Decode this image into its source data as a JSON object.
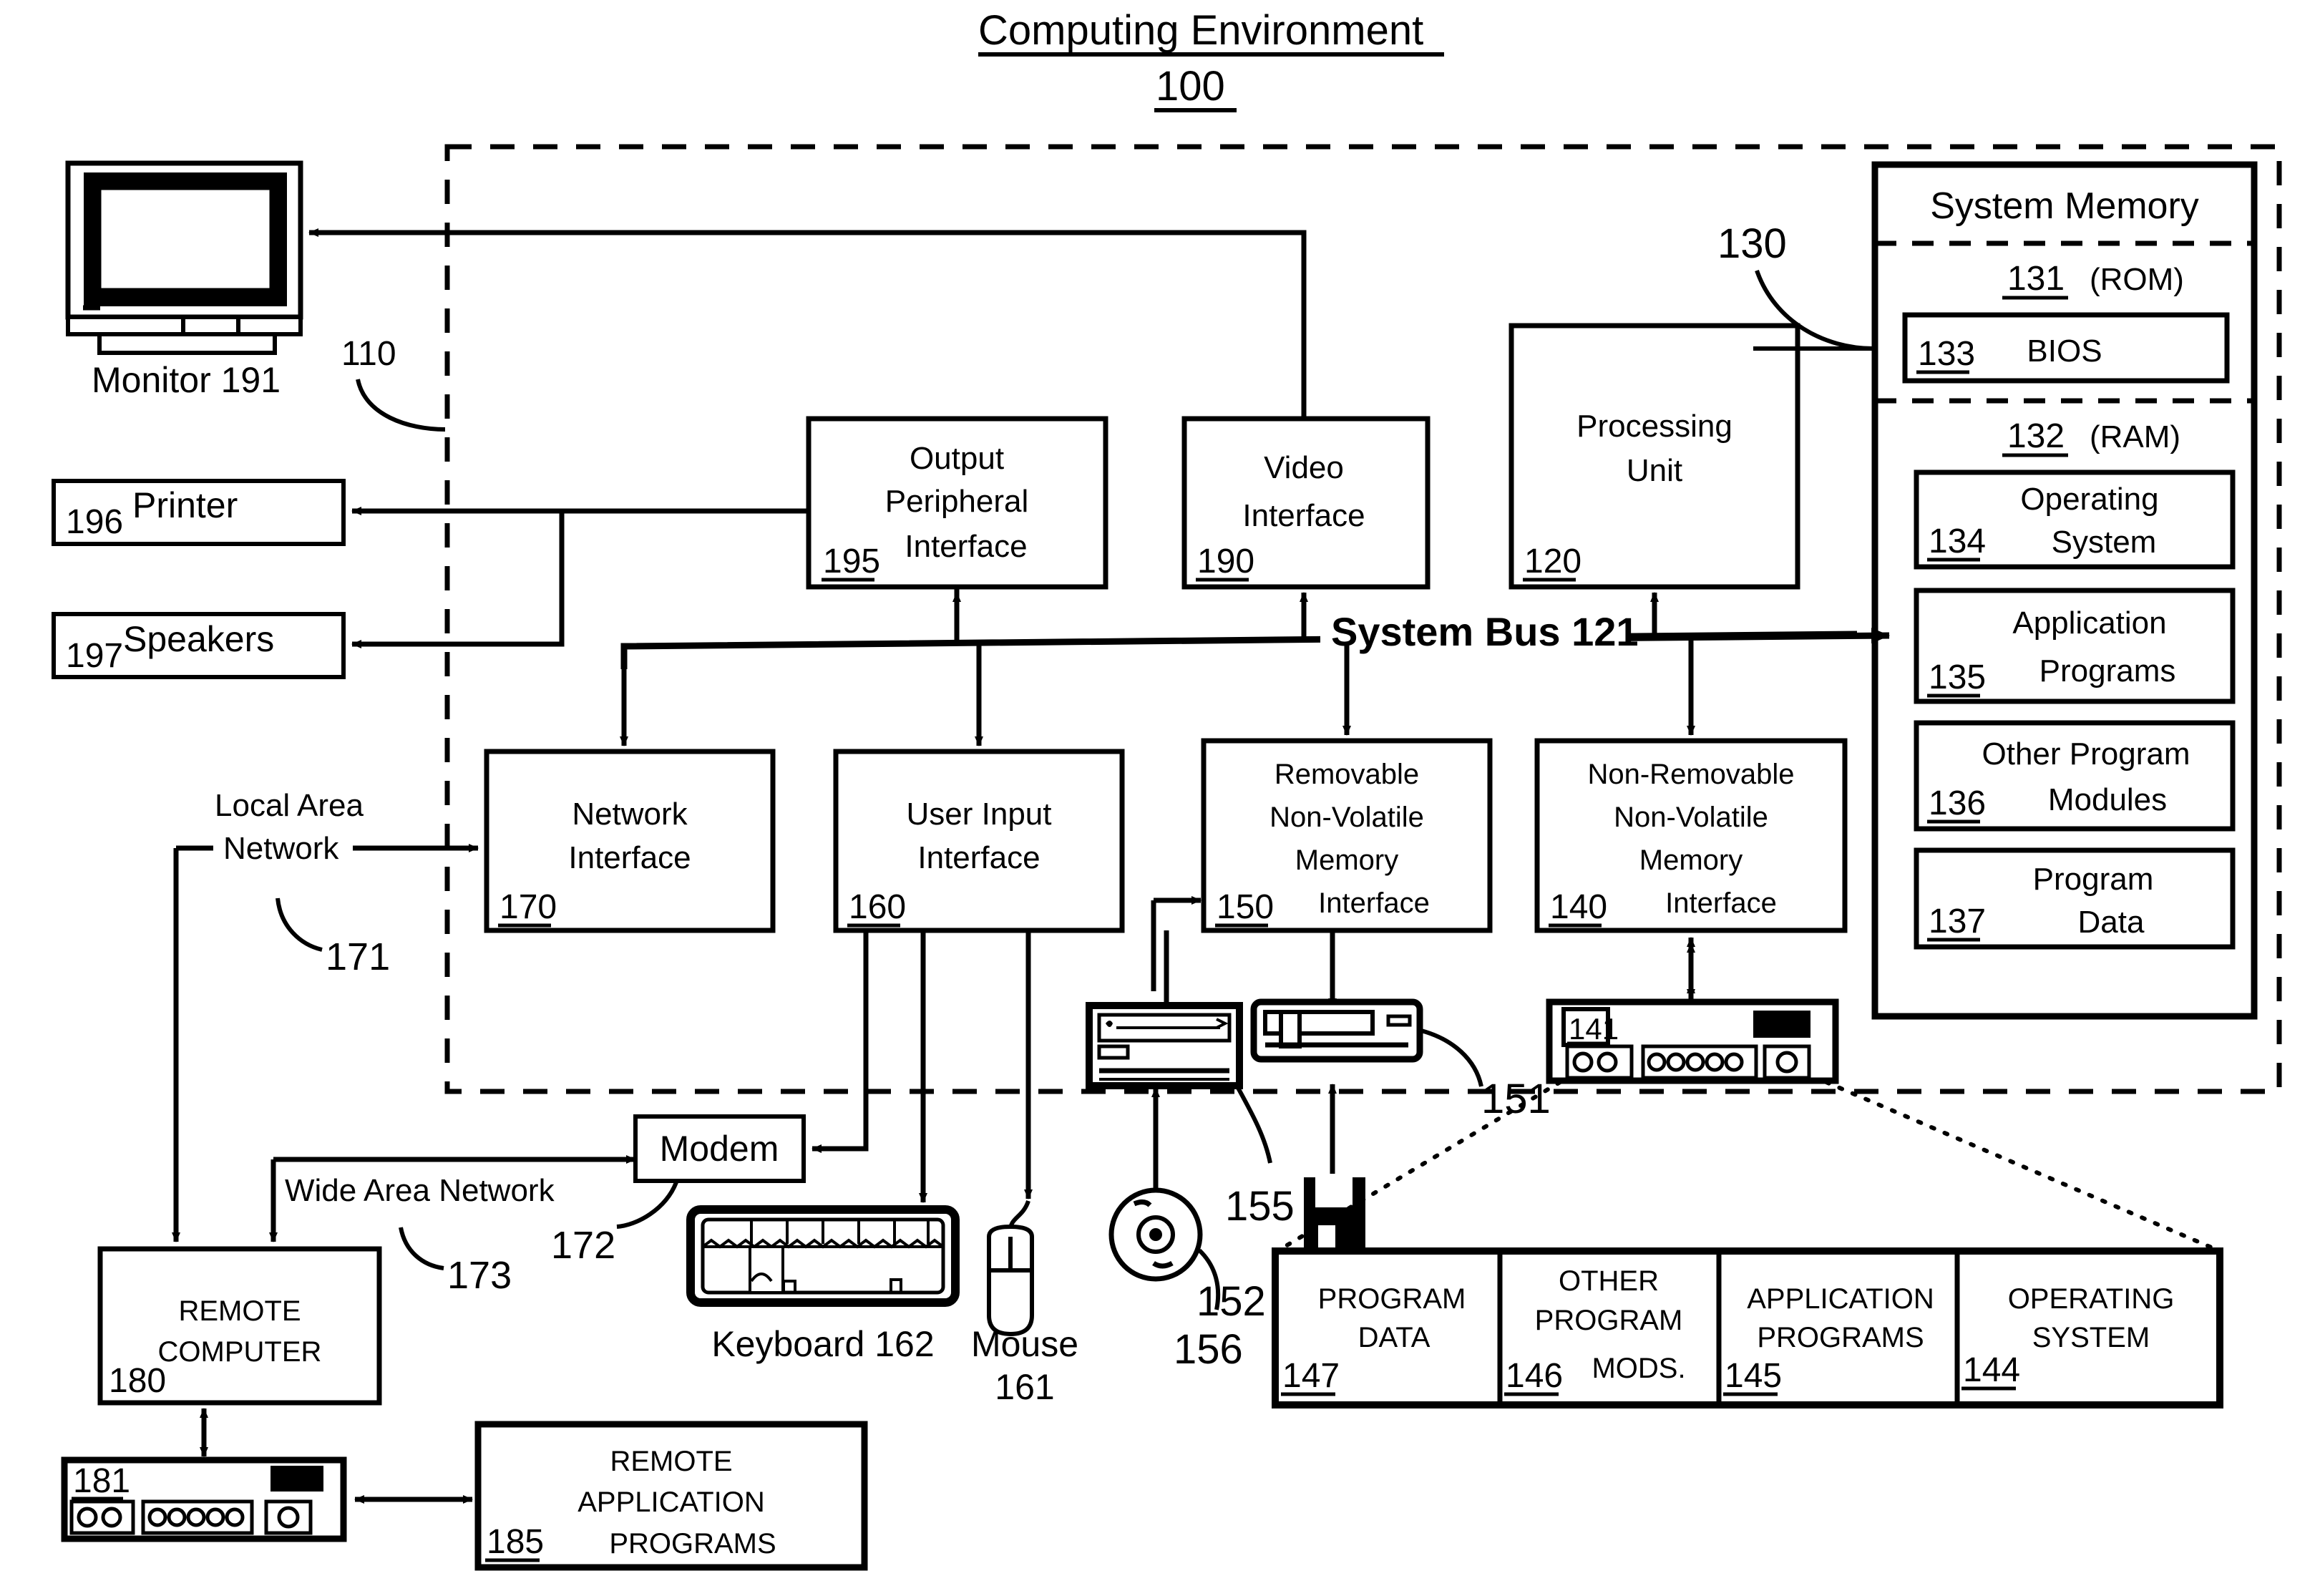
{
  "figure": {
    "title": "Computing Environment",
    "title_number": "100",
    "computer_boundary_ref": "110",
    "system_memory_ref": "130",
    "bus_label": "System Bus 121"
  },
  "system_memory": {
    "title": "System Memory",
    "rom": {
      "ref": "131",
      "label": "(ROM)"
    },
    "bios": {
      "ref": "133",
      "label": "BIOS"
    },
    "ram": {
      "ref": "132",
      "label": "(RAM)"
    },
    "ram_items": [
      {
        "ref": "134",
        "line1": "Operating",
        "line2": "System"
      },
      {
        "ref": "135",
        "line1": "Application",
        "line2": "Programs"
      },
      {
        "ref": "136",
        "line1": "Other Program",
        "line2": "Modules"
      },
      {
        "ref": "137",
        "line1": "Program",
        "line2": "Data"
      }
    ]
  },
  "core_boxes": [
    {
      "ref": "195",
      "lines": [
        "Output",
        "Peripheral",
        "Interface"
      ],
      "name": "output-peripheral-interface"
    },
    {
      "ref": "190",
      "lines": [
        "Video",
        "Interface"
      ],
      "name": "video-interface"
    },
    {
      "ref": "120",
      "lines": [
        "Processing",
        "Unit"
      ],
      "name": "processing-unit"
    },
    {
      "ref": "170",
      "lines": [
        "Network",
        "Interface"
      ],
      "name": "network-interface"
    },
    {
      "ref": "160",
      "lines": [
        "User Input",
        "Interface"
      ],
      "name": "user-input-interface"
    },
    {
      "ref": "150",
      "lines": [
        "Removable",
        "Non-Volatile",
        "Memory",
        "Interface"
      ],
      "name": "removable-nonvolatile-memory-interface"
    },
    {
      "ref": "140",
      "lines": [
        "Non-Removable",
        "Non-Volatile",
        "Memory",
        "Interface"
      ],
      "name": "nonremovable-nonvolatile-memory-interface"
    }
  ],
  "peripherals": {
    "monitor": {
      "label": "Monitor 191"
    },
    "printer": {
      "ref": "196",
      "label": "Printer"
    },
    "speakers": {
      "ref": "197",
      "label": "Speakers"
    },
    "keyboard": {
      "label": "Keyboard 162"
    },
    "mouse": {
      "label": "Mouse",
      "ref": "161"
    },
    "modem": {
      "label": "Modem",
      "ref": "172"
    },
    "optical_disc_ref": "156",
    "optical_drive_ref": "155",
    "floppy_disk_ref": "152",
    "hard_drive_ref": "141",
    "hard_drive_callout_ref": "151"
  },
  "networks": {
    "lan": {
      "line1": "Local Area",
      "line2": "Network",
      "ref": "171"
    },
    "wan": {
      "label": "Wide Area Network",
      "ref": "173"
    }
  },
  "remote": {
    "computer": {
      "line1": "REMOTE",
      "line2": "COMPUTER",
      "ref": "180"
    },
    "drive_ref": "181",
    "programs": {
      "line1": "REMOTE",
      "line2": "APPLICATION",
      "line3": "PROGRAMS",
      "ref": "185"
    }
  },
  "disk_contents": [
    {
      "ref": "147",
      "lines": [
        "PROGRAM",
        "DATA"
      ]
    },
    {
      "ref": "146",
      "lines": [
        "OTHER",
        "PROGRAM",
        "MODS."
      ]
    },
    {
      "ref": "145",
      "lines": [
        "APPLICATION",
        "PROGRAMS"
      ]
    },
    {
      "ref": "144",
      "lines": [
        "OPERATING",
        "SYSTEM"
      ]
    }
  ],
  "colors": {
    "ink": "#000000",
    "paper": "#ffffff"
  }
}
